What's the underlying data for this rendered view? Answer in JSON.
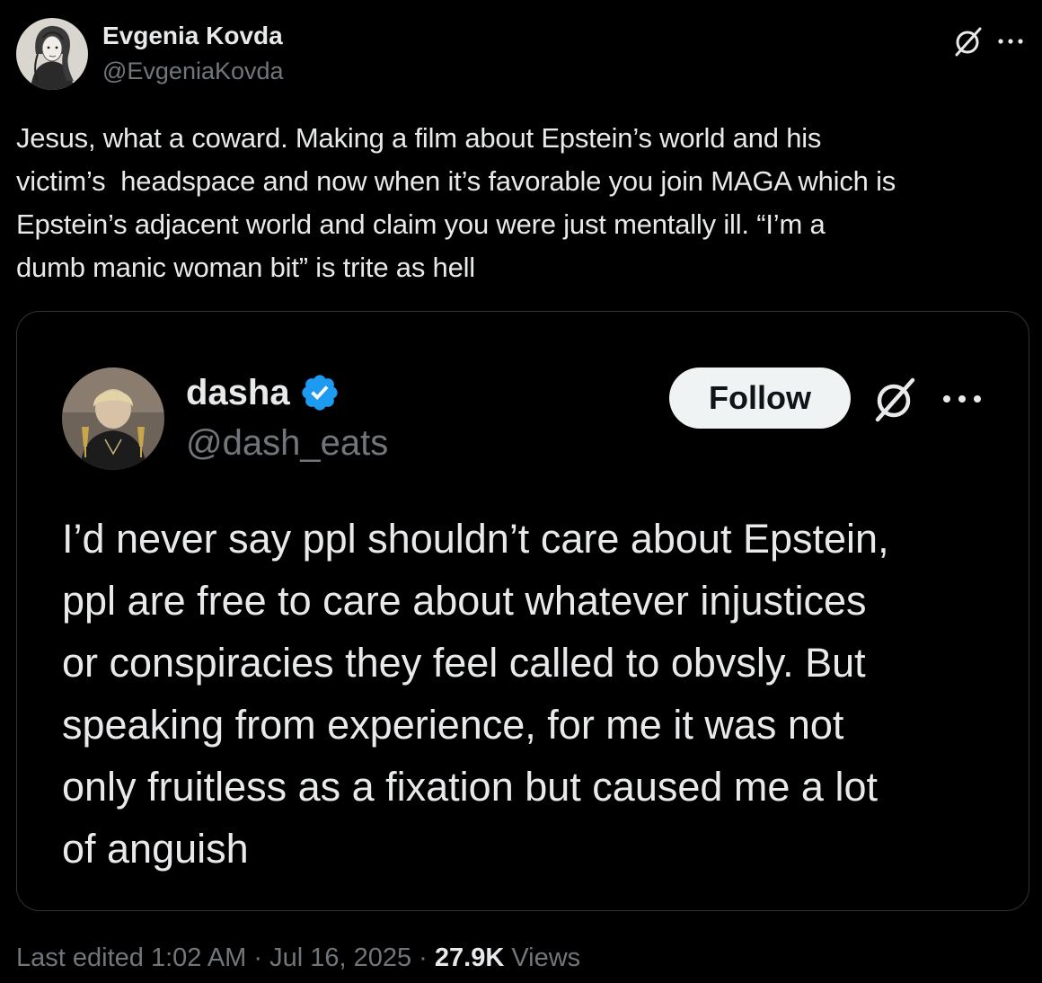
{
  "post": {
    "author": {
      "name": "Evgenia Kovda",
      "handle": "@EvgeniaKovda"
    },
    "text": "Jesus, what a coward. Making a film about Epstein’s world and his\nvictim’s  headspace and now when it’s favorable you join MAGA which is\nEpstein’s adjacent world and claim you were just mentally ill. “I’m a\ndumb manic woman bit” is trite as hell",
    "icons": {
      "grok": "grok-icon",
      "more": "more-icon"
    }
  },
  "quoted_post": {
    "author": {
      "name": "dasha",
      "handle": "@dash_eats",
      "verified": true
    },
    "follow_label": "Follow",
    "text": "I’d never say ppl shouldn’t care about Epstein,\nppl are free to care about whatever injustices\nor conspiracies they feel called to obvsly. But\nspeaking from experience, for me it was not\nonly fruitless as a fixation but caused me a lot\nof anguish",
    "icons": {
      "verified": "verified-badge-icon",
      "grok": "grok-icon",
      "more": "more-icon"
    }
  },
  "meta": {
    "edited_label": "Last edited 1:02 AM · Jul 16, 2025 · ",
    "views_count": "27.9K",
    "views_label": " Views"
  },
  "colors": {
    "background": "#000000",
    "text_primary": "#e7e9ea",
    "text_secondary": "#71767b",
    "border": "#2f3336",
    "verified_blue": "#1d9bf0",
    "follow_bg": "#eff3f4"
  }
}
